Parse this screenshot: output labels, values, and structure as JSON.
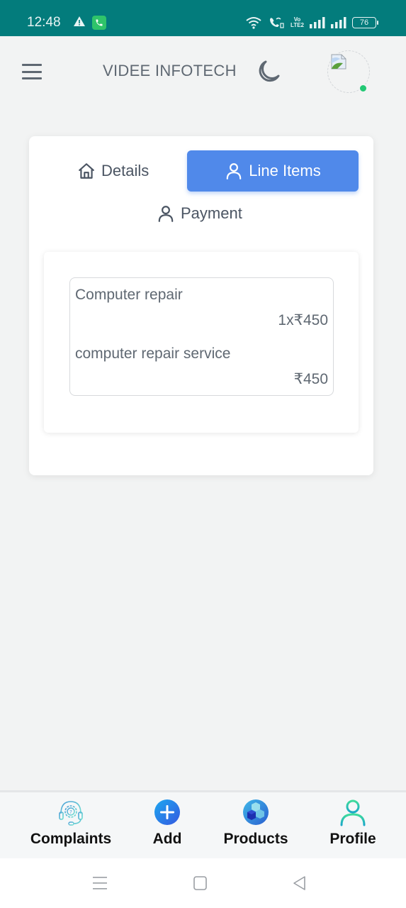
{
  "status_bar": {
    "time": "12:48",
    "battery": "76",
    "volte_line1": "Vo",
    "volte_line2": "LTE2",
    "icons": [
      "warning-icon",
      "call-notification-icon",
      "wifi-icon",
      "wifi-calling-icon",
      "volte-icon",
      "signal-icon",
      "signal-icon",
      "battery-icon"
    ]
  },
  "header": {
    "title": "VIDEE INFOTECH",
    "menu_icon": "hamburger-menu-icon",
    "theme_icon": "moon-icon",
    "avatar_status": "online"
  },
  "tabs": [
    {
      "label": "Details",
      "icon": "home-icon",
      "active": false
    },
    {
      "label": "Line Items",
      "icon": "user-icon",
      "active": true
    },
    {
      "label": "Payment",
      "icon": "user-icon",
      "active": false
    }
  ],
  "line_items": [
    {
      "name": "Computer repair",
      "quantity_price": "1x₹450",
      "description": "computer repair service",
      "total": "₹450"
    }
  ],
  "bottom_nav": [
    {
      "label": "Complaints",
      "icon": "support-headset-icon"
    },
    {
      "label": "Add",
      "icon": "plus-circle-icon"
    },
    {
      "label": "Products",
      "icon": "cubes-icon"
    },
    {
      "label": "Profile",
      "icon": "user-icon"
    }
  ],
  "colors": {
    "status_bar": "#037c7c",
    "accent": "#5089ea",
    "online": "#22c874",
    "text": "#5f6872"
  }
}
